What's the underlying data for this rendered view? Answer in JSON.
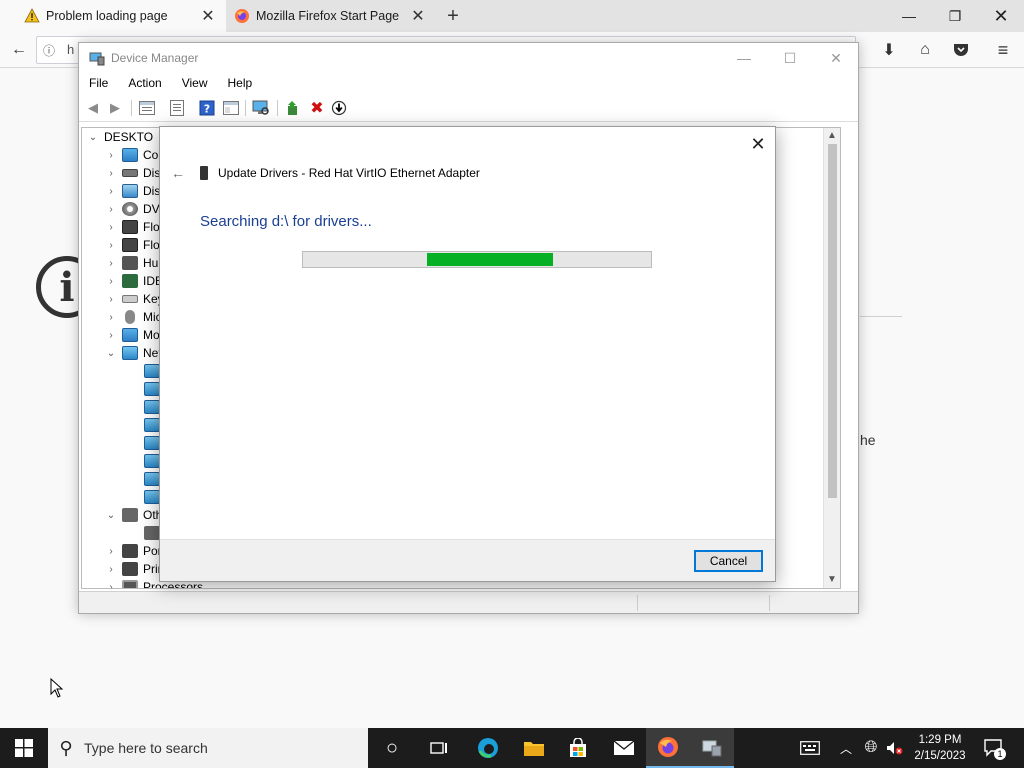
{
  "browser": {
    "tabs": [
      {
        "title": "Problem loading page",
        "icon": "warning-icon",
        "active": true
      },
      {
        "title": "Mozilla Firefox Start Page",
        "icon": "firefox-icon",
        "active": false
      }
    ],
    "url_partial": "h"
  },
  "error_page": {
    "visible_text_fragment": "he"
  },
  "device_manager": {
    "title": "Device Manager",
    "menu": [
      "File",
      "Action",
      "View",
      "Help"
    ],
    "tree": {
      "root": "DESKTO",
      "items": [
        {
          "label": "Cor",
          "icon": "computer-icon",
          "expanded": false
        },
        {
          "label": "Disl",
          "icon": "disk-drive-icon",
          "expanded": false
        },
        {
          "label": "Disp",
          "icon": "display-adapter-icon",
          "expanded": false
        },
        {
          "label": "DVD",
          "icon": "dvd-drive-icon",
          "expanded": false
        },
        {
          "label": "Flop",
          "icon": "floppy-controller-icon",
          "expanded": false
        },
        {
          "label": "Flop",
          "icon": "floppy-drive-icon",
          "expanded": false
        },
        {
          "label": "Hun",
          "icon": "hid-icon",
          "expanded": false
        },
        {
          "label": "IDE",
          "icon": "ide-controller-icon",
          "expanded": false
        },
        {
          "label": "Key",
          "icon": "keyboard-icon",
          "expanded": false
        },
        {
          "label": "Mic",
          "icon": "mouse-icon",
          "expanded": false
        },
        {
          "label": "Mo",
          "icon": "monitor-icon",
          "expanded": false
        },
        {
          "label": "Net",
          "icon": "network-adapter-icon",
          "expanded": true
        },
        {
          "label": "Oth",
          "icon": "other-devices-icon",
          "expanded": true
        },
        {
          "label": "Por",
          "icon": "ports-icon",
          "expanded": false
        },
        {
          "label": "Prir",
          "icon": "print-queue-icon",
          "expanded": false
        },
        {
          "label": "Processors",
          "icon": "processor-icon",
          "expanded": false
        }
      ],
      "network_children_count": 8
    }
  },
  "update_dialog": {
    "header": "Update Drivers - Red Hat VirtIO Ethernet Adapter",
    "status": "Searching d:\\ for drivers...",
    "progress_fill": {
      "start": 0.357,
      "end": 0.72
    },
    "cancel_label": "Cancel",
    "accent": "#06b025",
    "heading_color": "#1a3f95"
  },
  "taskbar": {
    "search_placeholder": "Type here to search",
    "time": "1:29 PM",
    "date": "2/15/2023",
    "notification_count": "1"
  }
}
